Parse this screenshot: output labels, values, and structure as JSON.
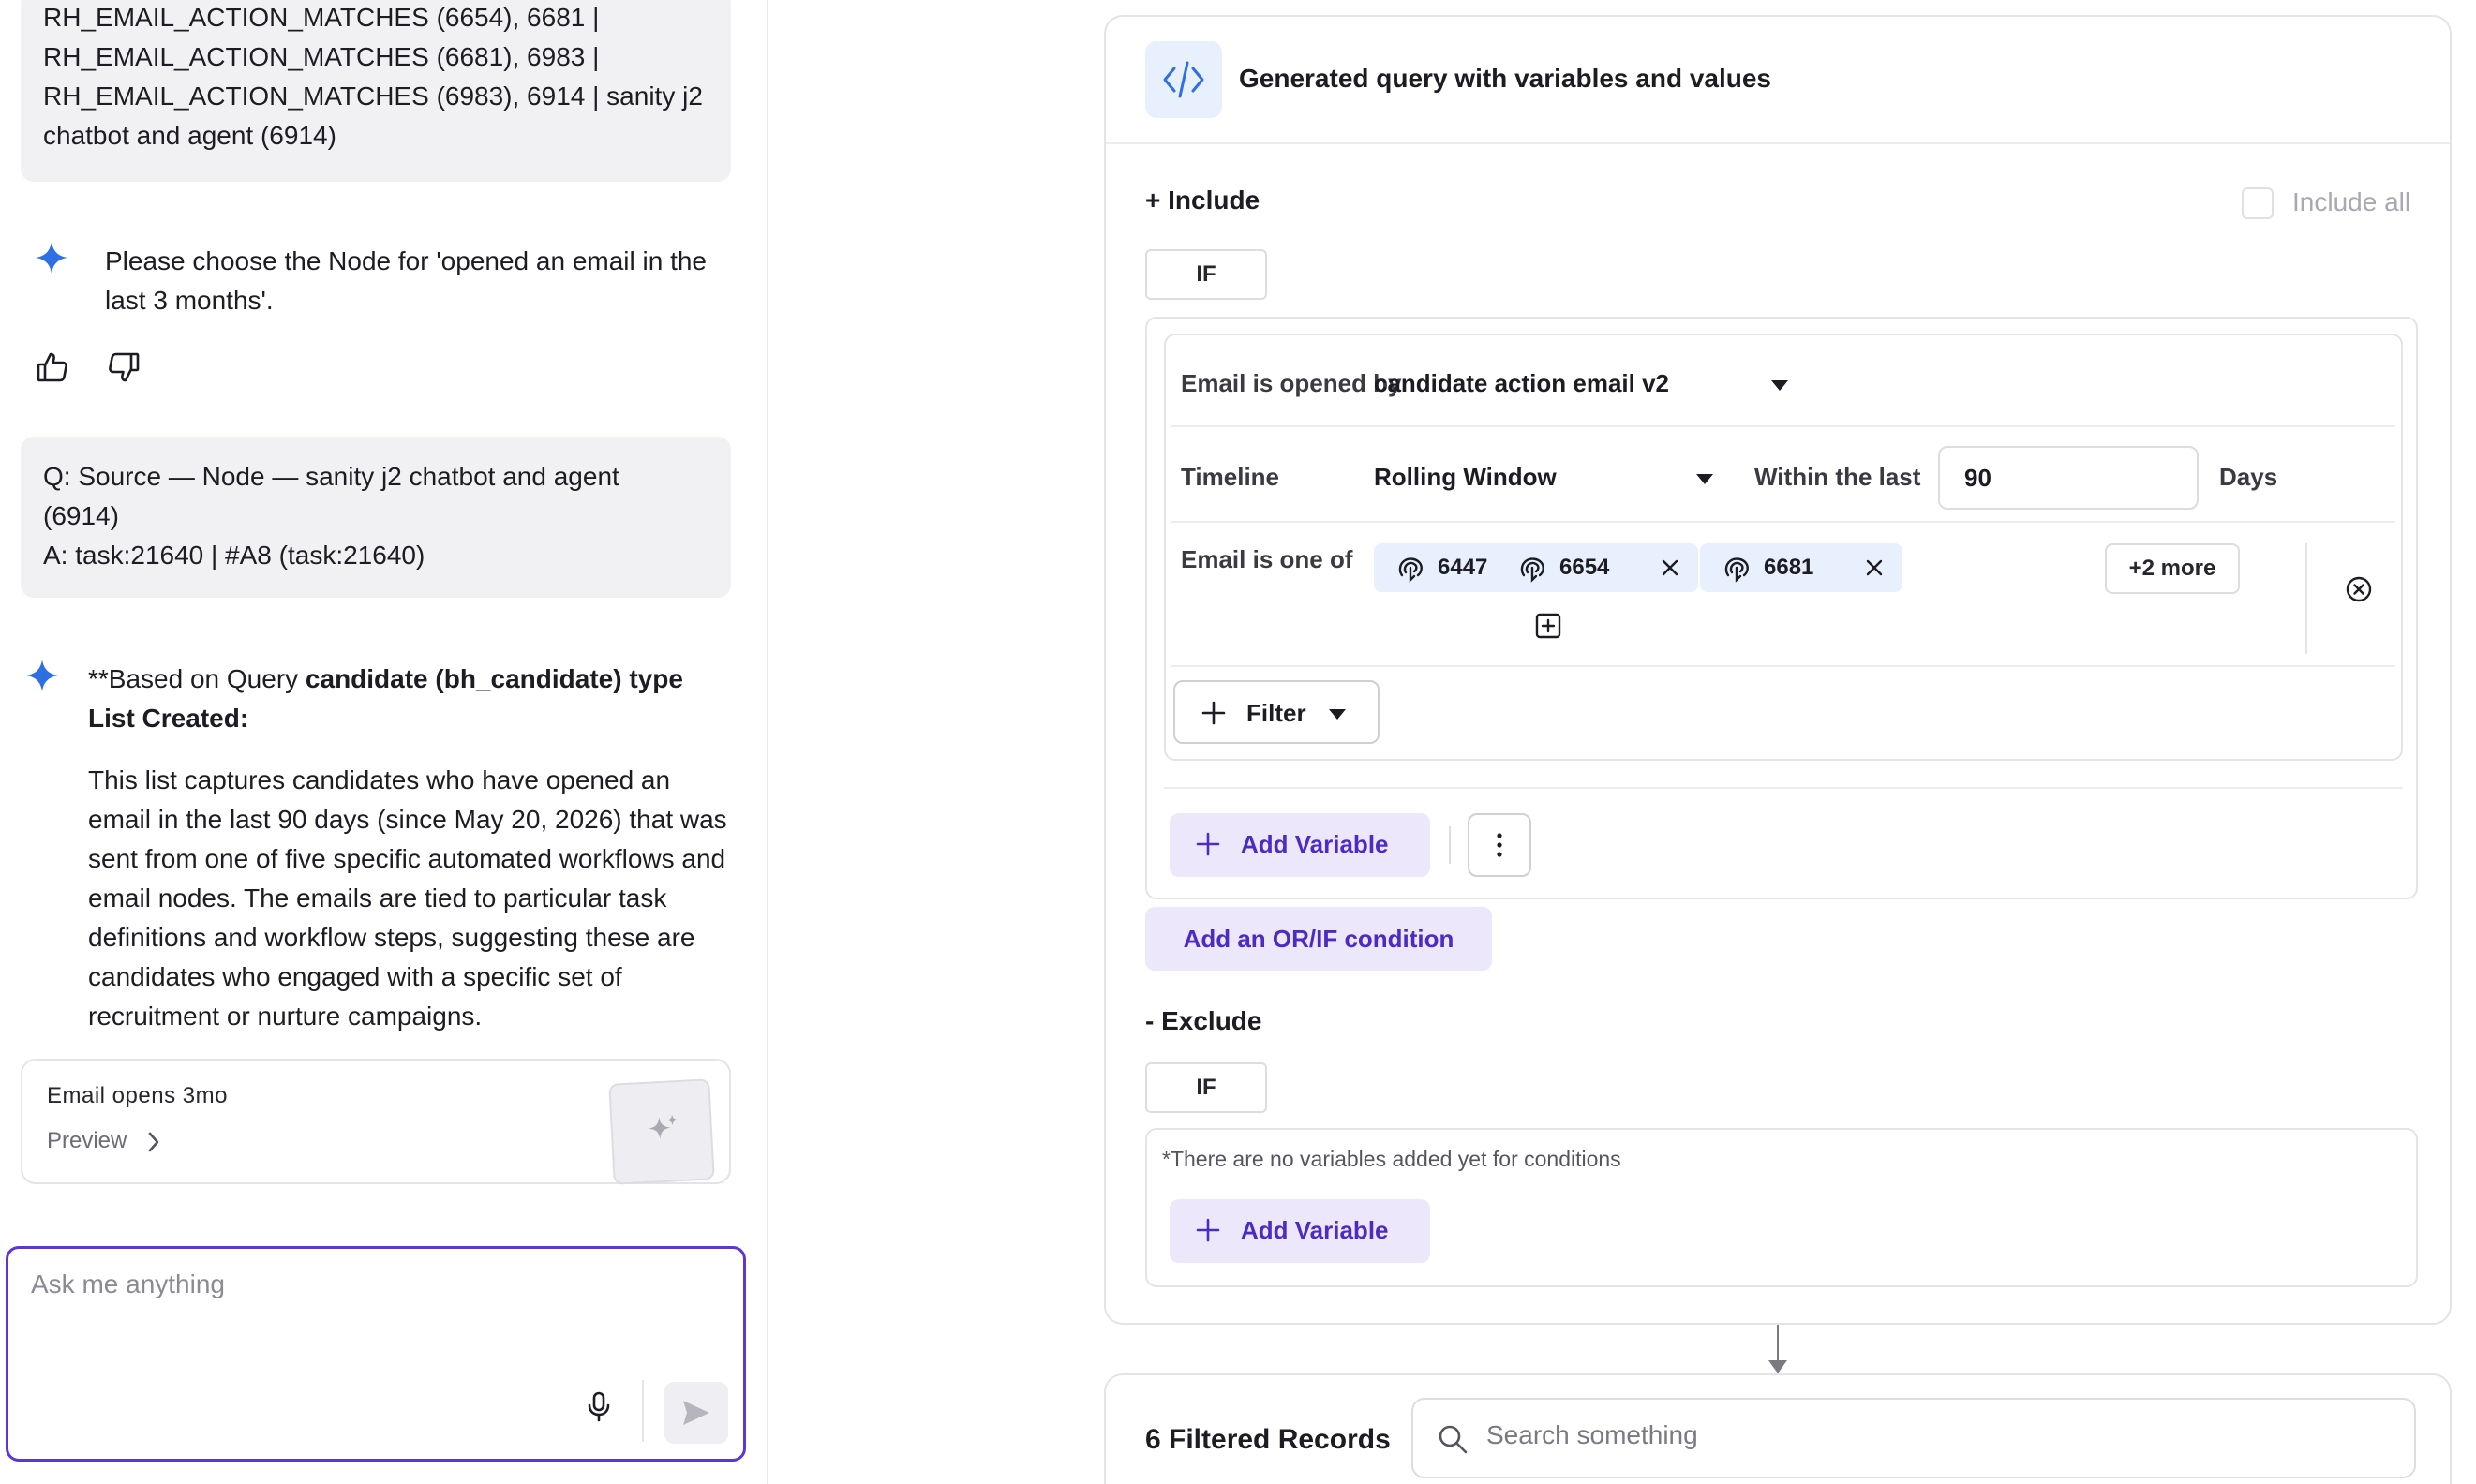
{
  "chat": {
    "bubble_1_lines": [
      "RH_EMAIL_ACTION_MATCHES (6654), 6681 |",
      "RH_EMAIL_ACTION_MATCHES (6681), 6983 |",
      "RH_EMAIL_ACTION_MATCHES (6983), 6914 | sanity j2",
      "chatbot and agent (6914)"
    ],
    "assistant_msg_1": "Please choose the Node for 'opened an email in the last 3 months'.",
    "bubble_2_lines": [
      "Q: Source — Node — sanity j2 chatbot and agent",
      "(6914)",
      "A: task:21640 | #A8 (task:21640)"
    ],
    "assistant_msg_2_prefix": "**Based on Query ",
    "assistant_msg_2_bold": "candidate (bh_candidate) type List Created:",
    "assistant_msg_2_body": "This list captures candidates who have opened an email in the last 90 days (since May 20, 2026) that was sent from one of five specific automated workflows and email nodes. The emails are tied to particular task definitions and workflow steps, suggesting these are candidates who engaged with a specific set of recruitment or nurture campaigns.",
    "list_card": {
      "title": "Email opens 3mo",
      "preview_label": "Preview"
    },
    "input_placeholder": "Ask me anything"
  },
  "query": {
    "title": "Generated query with variables and values",
    "include_label": "+ Include",
    "include_all_label": "Include all",
    "if_label": "IF",
    "conditions": {
      "email_opened_label": "Email is opened by",
      "email_opened_value": "candidate action email v2",
      "timeline_label": "Timeline",
      "timeline_value": "Rolling Window",
      "within_label": "Within the last",
      "within_value": "90",
      "days_label": "Days",
      "email_one_of_label": "Email is one of",
      "chips": [
        "6447",
        "6654",
        "6681"
      ],
      "more_label": "+2 more",
      "filter_label": "Filter"
    },
    "add_variable_label": "Add Variable",
    "or_if_label": "Add an OR/IF condition",
    "exclude_label": "- Exclude",
    "exclude_note": "*There are no variables added yet for conditions"
  },
  "records": {
    "count_label": "6 Filtered Records",
    "search_placeholder": "Search something"
  },
  "colors": {
    "accent": "#5b37d6",
    "accent_text": "#4b2bc4",
    "accent_bg": "#ece7fb",
    "chip_bg": "#e8f0fd",
    "sparkle": "#2f6fe4"
  }
}
